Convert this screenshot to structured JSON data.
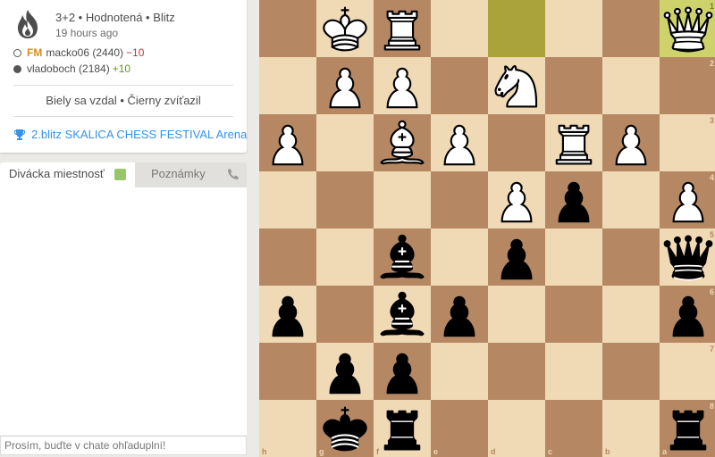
{
  "game": {
    "variant": "3+2 • Hodnotená • Blitz",
    "time_ago": "19 hours ago",
    "players": [
      {
        "color": "white",
        "title": "FM",
        "name": "macko06 (2440)",
        "diff": "−10"
      },
      {
        "color": "black",
        "title": "",
        "name": "vladoboch (2184)",
        "diff": "+10"
      }
    ],
    "result": "Biely sa vzdal • Čierny zvíťazil",
    "tournament": "2.blitz SKALICA CHESS FESTIVAL Arena"
  },
  "tabs": {
    "chat": "Divácka miestnosť",
    "notes": "Poznámky"
  },
  "chat": {
    "placeholder": "Prosím, buďte v chate ohľaduplní!"
  },
  "board": {
    "orientation": "black",
    "colors": {
      "light": "#f0d9b5",
      "dark": "#b58863",
      "highlight_light": "#cdd26a",
      "highlight_dark": "#aaa23a"
    },
    "highlighted_squares": [
      "d1",
      "a1"
    ],
    "files": [
      "h",
      "g",
      "f",
      "e",
      "d",
      "c",
      "b",
      "a"
    ],
    "ranks": [
      "1",
      "2",
      "3",
      "4",
      "5",
      "6",
      "7",
      "8"
    ],
    "pieces": {
      "g1": "wK",
      "f1": "wR",
      "a1": "wQ",
      "g2": "wP",
      "f2": "wP",
      "d2": "wN",
      "h3": "wP",
      "f3": "wB",
      "e3": "wP",
      "c3": "wR",
      "b3": "wP",
      "d4": "wP",
      "c4": "bP",
      "a4": "wP",
      "f5": "bB",
      "d5": "bP",
      "a5": "bQ",
      "h6": "bP",
      "f6": "bB",
      "e6": "bP",
      "a6": "bP",
      "g7": "bP",
      "f7": "bP",
      "g8": "bK",
      "f8": "bR",
      "a8": "bR"
    }
  }
}
